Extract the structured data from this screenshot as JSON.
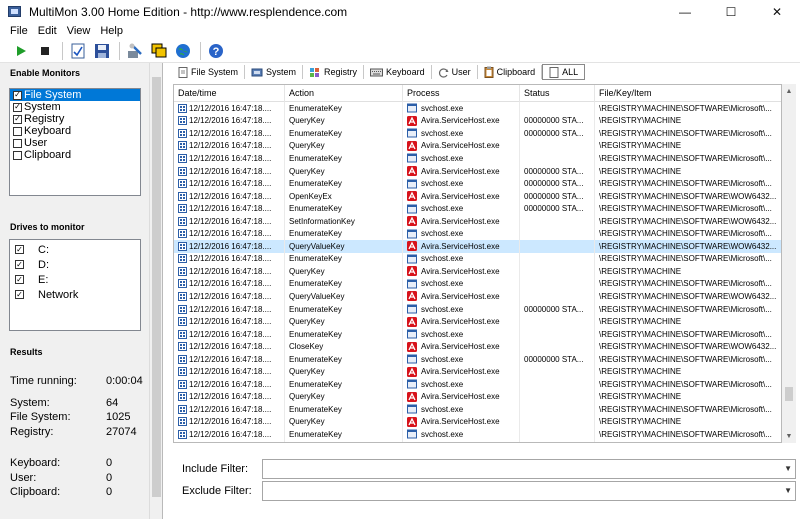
{
  "window": {
    "title": "MultiMon 3.00  Home Edition - http://www.resplendence.com",
    "minimize": "—",
    "maximize": "☐",
    "close": "✕"
  },
  "menu": [
    "File",
    "Edit",
    "View",
    "Help"
  ],
  "toolbar": {
    "buttons": [
      "play-icon",
      "stop-icon",
      "checklist-icon",
      "save-icon",
      "tools-icon",
      "windows-icon",
      "globe-icon",
      "help-icon"
    ]
  },
  "left": {
    "monitors_title": "Enable Monitors",
    "monitors": [
      {
        "label": "File System",
        "checked": true,
        "selected": true
      },
      {
        "label": "System",
        "checked": true,
        "selected": false
      },
      {
        "label": "Registry",
        "checked": true,
        "selected": false
      },
      {
        "label": "Keyboard",
        "checked": false,
        "selected": false
      },
      {
        "label": "User",
        "checked": false,
        "selected": false
      },
      {
        "label": "Clipboard",
        "checked": false,
        "selected": false
      }
    ],
    "drives_title": "Drives to monitor",
    "drives": [
      {
        "label": "C:",
        "checked": true
      },
      {
        "label": "D:",
        "checked": true
      },
      {
        "label": "E:",
        "checked": true
      },
      {
        "label": "Network",
        "checked": true
      }
    ],
    "results_title": "Results",
    "time_running_label": "Time running:",
    "time_running": "0:00:04",
    "system_label": "System:",
    "system": "64",
    "filesystem_label": "File System:",
    "filesystem": "1025",
    "registry_label": "Registry:",
    "registry": "27074",
    "keyboard_label": "Keyboard:",
    "keyboard": "0",
    "user_label": "User:",
    "user": "0",
    "clipboard_label": "Clipboard:",
    "clipboard": "0"
  },
  "tabs": [
    "File System",
    "System",
    "Registry",
    "Keyboard",
    "User",
    "Clipboard",
    "ALL"
  ],
  "grid": {
    "columns": [
      "Date/time",
      "Action",
      "Process",
      "Status",
      "File/Key/Item"
    ],
    "rows": [
      [
        "12/12/2016 16:47:18....",
        "EnumerateKey",
        "svchost.exe",
        "",
        "\\REGISTRY\\MACHINE\\SOFTWARE\\Microsoft\\..."
      ],
      [
        "12/12/2016 16:47:18....",
        "QueryKey",
        "Avira.ServiceHost.exe",
        "00000000  STA...",
        "\\REGISTRY\\MACHINE"
      ],
      [
        "12/12/2016 16:47:18....",
        "EnumerateKey",
        "svchost.exe",
        "00000000  STA...",
        "\\REGISTRY\\MACHINE\\SOFTWARE\\Microsoft\\..."
      ],
      [
        "12/12/2016 16:47:18....",
        "QueryKey",
        "Avira.ServiceHost.exe",
        "",
        "\\REGISTRY\\MACHINE"
      ],
      [
        "12/12/2016 16:47:18....",
        "EnumerateKey",
        "svchost.exe",
        "",
        "\\REGISTRY\\MACHINE\\SOFTWARE\\Microsoft\\..."
      ],
      [
        "12/12/2016 16:47:18....",
        "QueryKey",
        "Avira.ServiceHost.exe",
        "00000000  STA...",
        "\\REGISTRY\\MACHINE"
      ],
      [
        "12/12/2016 16:47:18....",
        "EnumerateKey",
        "svchost.exe",
        "00000000  STA...",
        "\\REGISTRY\\MACHINE\\SOFTWARE\\Microsoft\\..."
      ],
      [
        "12/12/2016 16:47:18....",
        "OpenKeyEx",
        "Avira.ServiceHost.exe",
        "00000000  STA...",
        "\\REGISTRY\\MACHINE\\SOFTWARE\\WOW6432..."
      ],
      [
        "12/12/2016 16:47:18....",
        "EnumerateKey",
        "svchost.exe",
        "00000000  STA...",
        "\\REGISTRY\\MACHINE\\SOFTWARE\\Microsoft\\..."
      ],
      [
        "12/12/2016 16:47:18....",
        "SetInformationKey",
        "Avira.ServiceHost.exe",
        "",
        "\\REGISTRY\\MACHINE\\SOFTWARE\\WOW6432..."
      ],
      [
        "12/12/2016 16:47:18....",
        "EnumerateKey",
        "svchost.exe",
        "",
        "\\REGISTRY\\MACHINE\\SOFTWARE\\Microsoft\\..."
      ],
      [
        "12/12/2016 16:47:18....",
        "QueryValueKey",
        "Avira.ServiceHost.exe",
        "",
        "\\REGISTRY\\MACHINE\\SOFTWARE\\WOW6432..."
      ],
      [
        "12/12/2016 16:47:18....",
        "EnumerateKey",
        "svchost.exe",
        "",
        "\\REGISTRY\\MACHINE\\SOFTWARE\\Microsoft\\..."
      ],
      [
        "12/12/2016 16:47:18....",
        "QueryKey",
        "Avira.ServiceHost.exe",
        "",
        "\\REGISTRY\\MACHINE"
      ],
      [
        "12/12/2016 16:47:18....",
        "EnumerateKey",
        "svchost.exe",
        "",
        "\\REGISTRY\\MACHINE\\SOFTWARE\\Microsoft\\..."
      ],
      [
        "12/12/2016 16:47:18....",
        "QueryValueKey",
        "Avira.ServiceHost.exe",
        "",
        "\\REGISTRY\\MACHINE\\SOFTWARE\\WOW6432..."
      ],
      [
        "12/12/2016 16:47:18....",
        "EnumerateKey",
        "svchost.exe",
        "00000000  STA...",
        "\\REGISTRY\\MACHINE\\SOFTWARE\\Microsoft\\..."
      ],
      [
        "12/12/2016 16:47:18....",
        "QueryKey",
        "Avira.ServiceHost.exe",
        "",
        "\\REGISTRY\\MACHINE"
      ],
      [
        "12/12/2016 16:47:18....",
        "EnumerateKey",
        "svchost.exe",
        "",
        "\\REGISTRY\\MACHINE\\SOFTWARE\\Microsoft\\..."
      ],
      [
        "12/12/2016 16:47:18....",
        "CloseKey",
        "Avira.ServiceHost.exe",
        "",
        "\\REGISTRY\\MACHINE\\SOFTWARE\\WOW6432..."
      ],
      [
        "12/12/2016 16:47:18....",
        "EnumerateKey",
        "svchost.exe",
        "00000000  STA...",
        "\\REGISTRY\\MACHINE\\SOFTWARE\\Microsoft\\..."
      ],
      [
        "12/12/2016 16:47:18....",
        "QueryKey",
        "Avira.ServiceHost.exe",
        "",
        "\\REGISTRY\\MACHINE"
      ],
      [
        "12/12/2016 16:47:18....",
        "EnumerateKey",
        "svchost.exe",
        "",
        "\\REGISTRY\\MACHINE\\SOFTWARE\\Microsoft\\..."
      ],
      [
        "12/12/2016 16:47:18....",
        "QueryKey",
        "Avira.ServiceHost.exe",
        "",
        "\\REGISTRY\\MACHINE"
      ],
      [
        "12/12/2016 16:47:18....",
        "EnumerateKey",
        "svchost.exe",
        "",
        "\\REGISTRY\\MACHINE\\SOFTWARE\\Microsoft\\..."
      ],
      [
        "12/12/2016 16:47:18....",
        "QueryKey",
        "Avira.ServiceHost.exe",
        "",
        "\\REGISTRY\\MACHINE"
      ],
      [
        "12/12/2016 16:47:18....",
        "EnumerateKey",
        "svchost.exe",
        "",
        "\\REGISTRY\\MACHINE\\SOFTWARE\\Microsoft\\..."
      ],
      [
        "12/12/2016 16:47:18....",
        "QueryKey",
        "Avira.ServiceHost.exe",
        "",
        "\\REGISTRY\\MACHINE"
      ]
    ],
    "selected_row": 11
  },
  "filters": {
    "include_label": "Include Filter:",
    "include_value": "",
    "exclude_label": "Exclude Filter:",
    "exclude_value": ""
  },
  "colors": {
    "selection_blue": "#0078d7",
    "row_highlight": "#cce8ff",
    "avira_red": "#d7131b",
    "svchost_blue": "#2b5ea8"
  }
}
